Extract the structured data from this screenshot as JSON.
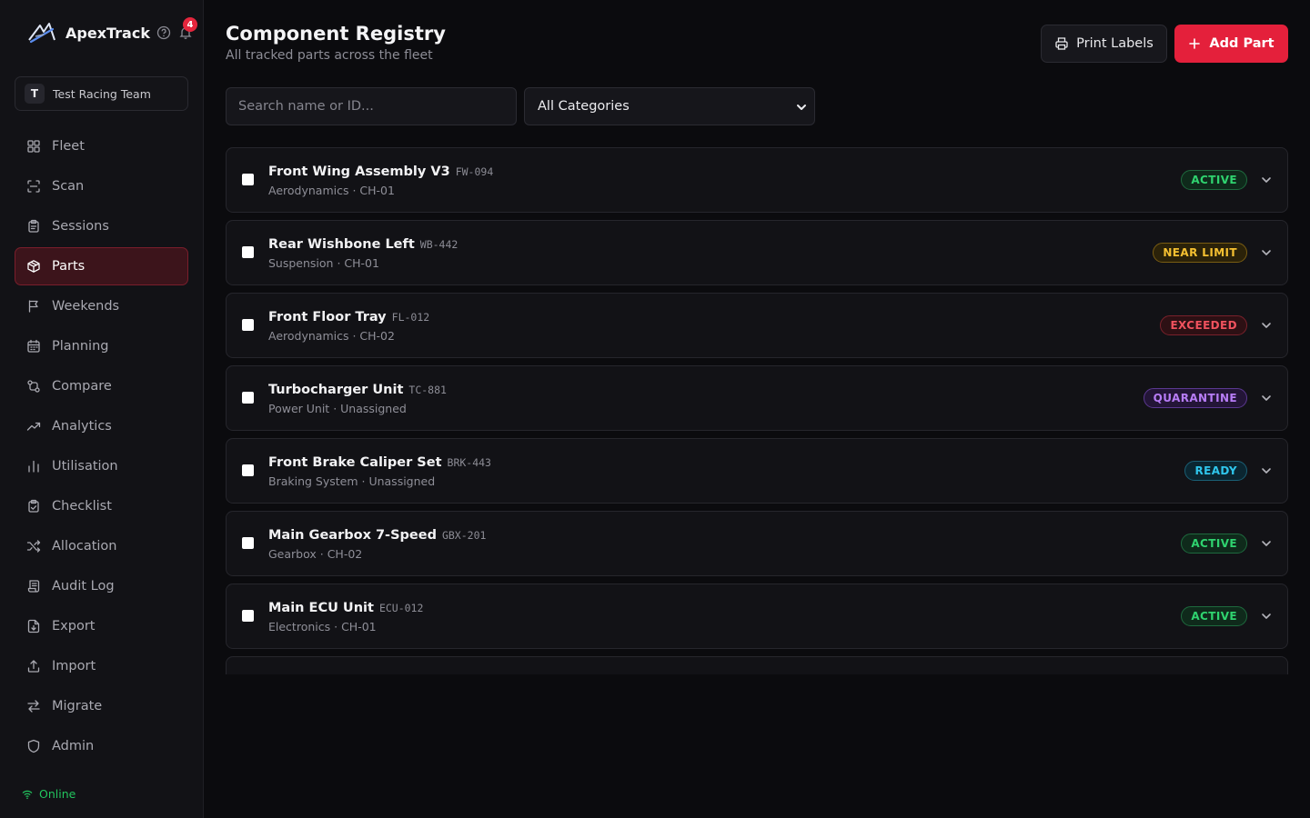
{
  "app": {
    "name": "ApexTrack",
    "notification_count": "4",
    "team_initial": "T",
    "team_name": "Test Racing Team",
    "status": "Online"
  },
  "nav": [
    {
      "id": "fleet",
      "label": "Fleet",
      "icon": "grid-icon"
    },
    {
      "id": "scan",
      "label": "Scan",
      "icon": "scan-icon"
    },
    {
      "id": "sessions",
      "label": "Sessions",
      "icon": "clipboard-icon"
    },
    {
      "id": "parts",
      "label": "Parts",
      "icon": "package-icon",
      "active": true
    },
    {
      "id": "weekends",
      "label": "Weekends",
      "icon": "flag-icon"
    },
    {
      "id": "planning",
      "label": "Planning",
      "icon": "calendar-icon"
    },
    {
      "id": "compare",
      "label": "Compare",
      "icon": "compare-icon"
    },
    {
      "id": "analytics",
      "label": "Analytics",
      "icon": "trending-icon"
    },
    {
      "id": "utilisation",
      "label": "Utilisation",
      "icon": "bar-chart-icon"
    },
    {
      "id": "checklist",
      "label": "Checklist",
      "icon": "clipboard-check-icon"
    },
    {
      "id": "allocation",
      "label": "Allocation",
      "icon": "shuffle-icon"
    },
    {
      "id": "audit-log",
      "label": "Audit Log",
      "icon": "scroll-icon"
    },
    {
      "id": "export",
      "label": "Export",
      "icon": "file-export-icon"
    },
    {
      "id": "import",
      "label": "Import",
      "icon": "upload-icon"
    },
    {
      "id": "migrate",
      "label": "Migrate",
      "icon": "swap-icon"
    },
    {
      "id": "admin",
      "label": "Admin",
      "icon": "shield-icon"
    }
  ],
  "header": {
    "title": "Component Registry",
    "subtitle": "All tracked parts across the fleet",
    "print_label": "Print Labels",
    "add_label": "Add Part"
  },
  "filters": {
    "search_placeholder": "Search name or ID...",
    "category_selected": "All Categories"
  },
  "colors": {
    "accent": "#e4203b",
    "active": "#2fd36f",
    "near_limit": "#f5c031",
    "exceeded": "#f0525e",
    "quarantine": "#b77cf6",
    "ready": "#2fc6ec"
  },
  "parts": [
    {
      "name": "Front Wing Assembly V3",
      "code": "FW-094",
      "category": "Aerodynamics",
      "chassis": "CH-01",
      "status": "ACTIVE",
      "status_kind": "active"
    },
    {
      "name": "Rear Wishbone Left",
      "code": "WB-442",
      "category": "Suspension",
      "chassis": "CH-01",
      "status": "NEAR LIMIT",
      "status_kind": "near"
    },
    {
      "name": "Front Floor Tray",
      "code": "FL-012",
      "category": "Aerodynamics",
      "chassis": "CH-02",
      "status": "EXCEEDED",
      "status_kind": "exceeded"
    },
    {
      "name": "Turbocharger Unit",
      "code": "TC-881",
      "category": "Power Unit",
      "chassis": "Unassigned",
      "status": "QUARANTINE",
      "status_kind": "quarantine"
    },
    {
      "name": "Front Brake Caliper Set",
      "code": "BRK-443",
      "category": "Braking System",
      "chassis": "Unassigned",
      "status": "READY",
      "status_kind": "ready"
    },
    {
      "name": "Main Gearbox 7-Speed",
      "code": "GBX-201",
      "category": "Gearbox",
      "chassis": "CH-02",
      "status": "ACTIVE",
      "status_kind": "active"
    },
    {
      "name": "Main ECU Unit",
      "code": "ECU-012",
      "category": "Electronics",
      "chassis": "CH-01",
      "status": "ACTIVE",
      "status_kind": "active"
    }
  ]
}
